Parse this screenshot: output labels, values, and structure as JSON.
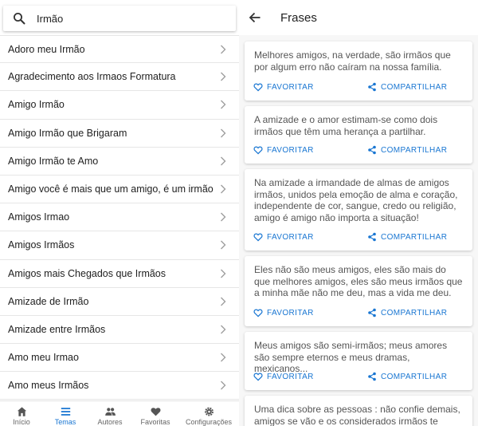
{
  "search": {
    "value": "Irmão",
    "icon": "search-icon"
  },
  "topics": [
    "Adoro meu Irmão",
    "Agradecimento aos Irmaos Formatura",
    "Amigo Irmão",
    "Amigo Irmão que Brigaram",
    "Amigo Irmão te Amo",
    "Amigo você é mais que um amigo, é um irmão",
    "Amigos Irmao",
    "Amigos Irmãos",
    "Amigos mais Chegados que Irmãos",
    "Amizade de Irmão",
    "Amizade entre Irmãos",
    "Amo meu Irmao",
    "Amo meus Irmãos"
  ],
  "bottom_nav": [
    {
      "label": "Início",
      "icon": "home-icon"
    },
    {
      "label": "Temas",
      "icon": "list-icon",
      "active": true
    },
    {
      "label": "Autores",
      "icon": "people-icon"
    },
    {
      "label": "Favoritas",
      "icon": "heart-icon"
    },
    {
      "label": "Configurações",
      "icon": "gear-icon"
    }
  ],
  "header": {
    "title": "Frases"
  },
  "actions": {
    "favorite": "FAVORITAR",
    "share": "COMPARTILHAR"
  },
  "phrases": [
    "Melhores amigos, na verdade, são irmãos que por algum erro não caíram na nossa família.",
    "A amizade e o amor estimam-se como dois irmãos que têm uma herança a partilhar.",
    "Na amizade a irmandade de almas de amigos irmãos, unidos pela emoção de alma e coração, independente de cor, sangue, credo ou religião, amigo é amigo não importa a situação!",
    "Eles não são meus amigos, eles são mais do que melhores amigos, eles são meus irmãos que a minha mãe não me deu, mas a vida me deu.",
    "Meus amigos são semi-irmãos; meus amores são sempre eternos e meus dramas, mexicanos...",
    "Uma dica sobre as pessoas : não confie demais, amigos se vão e os considerados irmãos te"
  ],
  "colors": {
    "accent": "#1976d2",
    "text": "#212121",
    "muted": "#555555"
  }
}
